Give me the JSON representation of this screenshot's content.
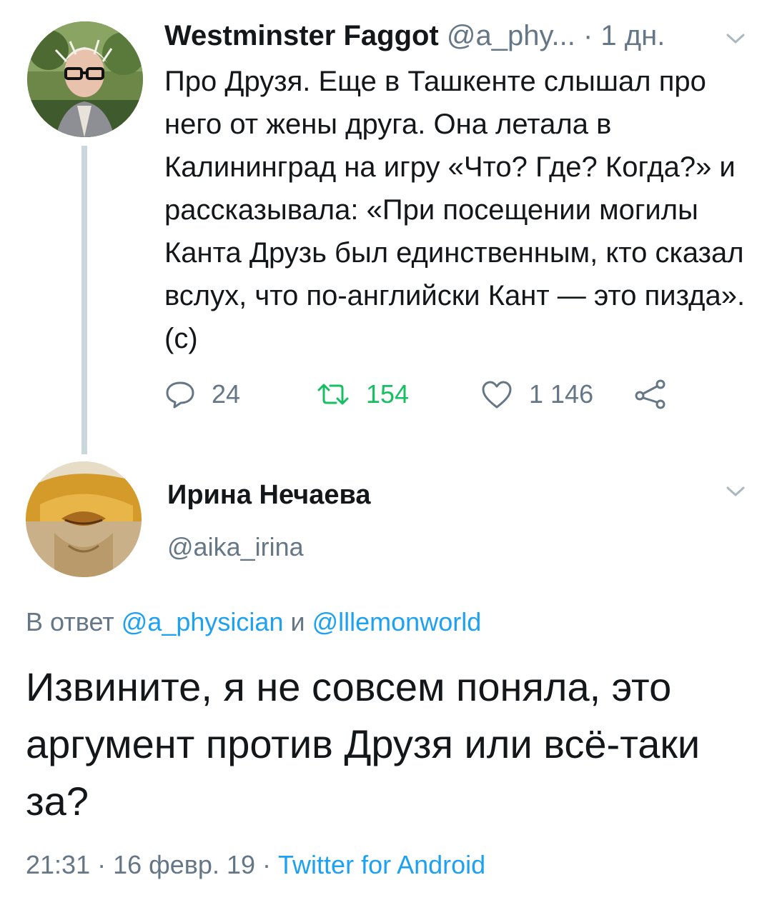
{
  "parent_tweet": {
    "author_name": "Westminster Faggot",
    "author_handle": "@a_phy...",
    "separator": "·",
    "time": "1 дн.",
    "text": "Про Друзя. Еще в Ташкенте слышал про него от жены друга. Она летала в Калининград на игру «Что? Где? Когда?» и рассказывала: «При посещении могилы Канта Друзь был единственным, кто сказал вслух, что по-английски Кант — это пизда». (с)",
    "actions": {
      "replies": "24",
      "retweets": "154",
      "likes": "1 146"
    }
  },
  "reply_tweet": {
    "author_name": "Ирина Нечаева",
    "author_handle": "@aika_irina",
    "reply_to": {
      "prefix": "В ответ",
      "mention_1": "@a_physician",
      "conjunction": "и",
      "mention_2": "@lllemonworld"
    },
    "text": "Извините, я не совсем поняла, это аргумент против Друзя или всё-таки за?",
    "meta": {
      "time": "21:31",
      "dot_1": "·",
      "date": "16 февр. 19",
      "dot_2": "·",
      "source": "Twitter for Android"
    }
  },
  "colors": {
    "text": "#14171a",
    "muted": "#657786",
    "link": "#1da1f2",
    "retweet": "#17bf63",
    "thread_line": "#ccd6dd"
  },
  "icons": [
    "reply-icon",
    "retweet-icon",
    "like-icon",
    "share-icon",
    "chevron-down-icon"
  ]
}
